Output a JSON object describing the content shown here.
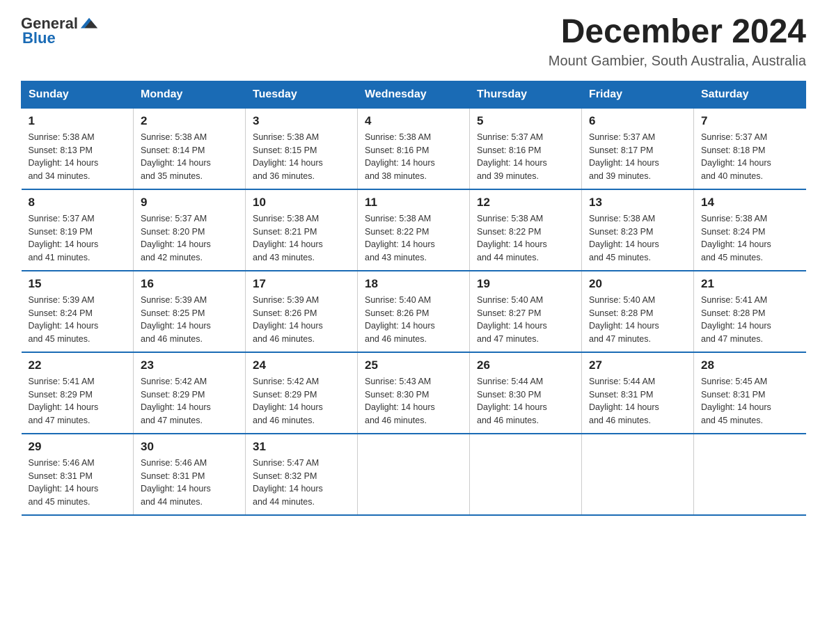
{
  "logo": {
    "general": "General",
    "blue": "Blue"
  },
  "title": "December 2024",
  "subtitle": "Mount Gambier, South Australia, Australia",
  "weekdays": [
    "Sunday",
    "Monday",
    "Tuesday",
    "Wednesday",
    "Thursday",
    "Friday",
    "Saturday"
  ],
  "weeks": [
    [
      {
        "day": "1",
        "sunrise": "5:38 AM",
        "sunset": "8:13 PM",
        "daylight": "14 hours and 34 minutes."
      },
      {
        "day": "2",
        "sunrise": "5:38 AM",
        "sunset": "8:14 PM",
        "daylight": "14 hours and 35 minutes."
      },
      {
        "day": "3",
        "sunrise": "5:38 AM",
        "sunset": "8:15 PM",
        "daylight": "14 hours and 36 minutes."
      },
      {
        "day": "4",
        "sunrise": "5:38 AM",
        "sunset": "8:16 PM",
        "daylight": "14 hours and 38 minutes."
      },
      {
        "day": "5",
        "sunrise": "5:37 AM",
        "sunset": "8:16 PM",
        "daylight": "14 hours and 39 minutes."
      },
      {
        "day": "6",
        "sunrise": "5:37 AM",
        "sunset": "8:17 PM",
        "daylight": "14 hours and 39 minutes."
      },
      {
        "day": "7",
        "sunrise": "5:37 AM",
        "sunset": "8:18 PM",
        "daylight": "14 hours and 40 minutes."
      }
    ],
    [
      {
        "day": "8",
        "sunrise": "5:37 AM",
        "sunset": "8:19 PM",
        "daylight": "14 hours and 41 minutes."
      },
      {
        "day": "9",
        "sunrise": "5:37 AM",
        "sunset": "8:20 PM",
        "daylight": "14 hours and 42 minutes."
      },
      {
        "day": "10",
        "sunrise": "5:38 AM",
        "sunset": "8:21 PM",
        "daylight": "14 hours and 43 minutes."
      },
      {
        "day": "11",
        "sunrise": "5:38 AM",
        "sunset": "8:22 PM",
        "daylight": "14 hours and 43 minutes."
      },
      {
        "day": "12",
        "sunrise": "5:38 AM",
        "sunset": "8:22 PM",
        "daylight": "14 hours and 44 minutes."
      },
      {
        "day": "13",
        "sunrise": "5:38 AM",
        "sunset": "8:23 PM",
        "daylight": "14 hours and 45 minutes."
      },
      {
        "day": "14",
        "sunrise": "5:38 AM",
        "sunset": "8:24 PM",
        "daylight": "14 hours and 45 minutes."
      }
    ],
    [
      {
        "day": "15",
        "sunrise": "5:39 AM",
        "sunset": "8:24 PM",
        "daylight": "14 hours and 45 minutes."
      },
      {
        "day": "16",
        "sunrise": "5:39 AM",
        "sunset": "8:25 PM",
        "daylight": "14 hours and 46 minutes."
      },
      {
        "day": "17",
        "sunrise": "5:39 AM",
        "sunset": "8:26 PM",
        "daylight": "14 hours and 46 minutes."
      },
      {
        "day": "18",
        "sunrise": "5:40 AM",
        "sunset": "8:26 PM",
        "daylight": "14 hours and 46 minutes."
      },
      {
        "day": "19",
        "sunrise": "5:40 AM",
        "sunset": "8:27 PM",
        "daylight": "14 hours and 47 minutes."
      },
      {
        "day": "20",
        "sunrise": "5:40 AM",
        "sunset": "8:28 PM",
        "daylight": "14 hours and 47 minutes."
      },
      {
        "day": "21",
        "sunrise": "5:41 AM",
        "sunset": "8:28 PM",
        "daylight": "14 hours and 47 minutes."
      }
    ],
    [
      {
        "day": "22",
        "sunrise": "5:41 AM",
        "sunset": "8:29 PM",
        "daylight": "14 hours and 47 minutes."
      },
      {
        "day": "23",
        "sunrise": "5:42 AM",
        "sunset": "8:29 PM",
        "daylight": "14 hours and 47 minutes."
      },
      {
        "day": "24",
        "sunrise": "5:42 AM",
        "sunset": "8:29 PM",
        "daylight": "14 hours and 46 minutes."
      },
      {
        "day": "25",
        "sunrise": "5:43 AM",
        "sunset": "8:30 PM",
        "daylight": "14 hours and 46 minutes."
      },
      {
        "day": "26",
        "sunrise": "5:44 AM",
        "sunset": "8:30 PM",
        "daylight": "14 hours and 46 minutes."
      },
      {
        "day": "27",
        "sunrise": "5:44 AM",
        "sunset": "8:31 PM",
        "daylight": "14 hours and 46 minutes."
      },
      {
        "day": "28",
        "sunrise": "5:45 AM",
        "sunset": "8:31 PM",
        "daylight": "14 hours and 45 minutes."
      }
    ],
    [
      {
        "day": "29",
        "sunrise": "5:46 AM",
        "sunset": "8:31 PM",
        "daylight": "14 hours and 45 minutes."
      },
      {
        "day": "30",
        "sunrise": "5:46 AM",
        "sunset": "8:31 PM",
        "daylight": "14 hours and 44 minutes."
      },
      {
        "day": "31",
        "sunrise": "5:47 AM",
        "sunset": "8:32 PM",
        "daylight": "14 hours and 44 minutes."
      },
      null,
      null,
      null,
      null
    ]
  ],
  "labels": {
    "sunrise": "Sunrise:",
    "sunset": "Sunset:",
    "daylight": "Daylight:"
  }
}
